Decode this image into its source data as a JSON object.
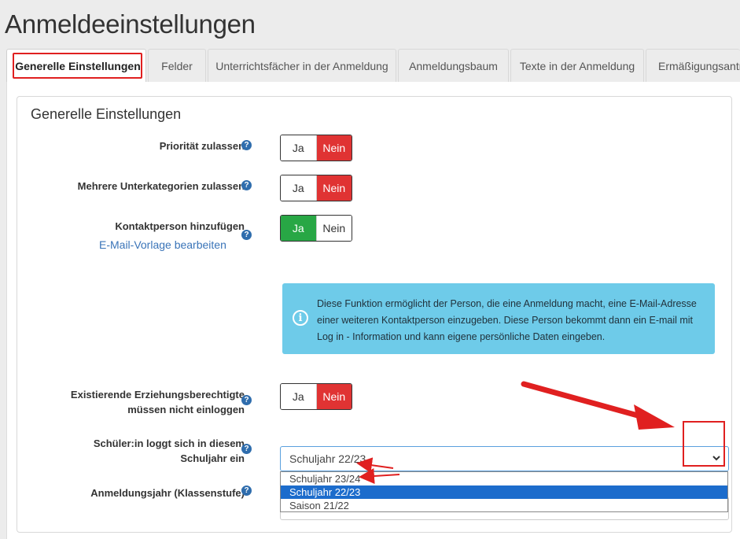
{
  "page": {
    "title": "Anmeldeeinstellungen"
  },
  "tabs": [
    {
      "label": "Generelle Einstellungen",
      "active": true
    },
    {
      "label": "Felder"
    },
    {
      "label": "Unterrichtsfächer in der Anmeldung"
    },
    {
      "label": "Anmeldungsbaum"
    },
    {
      "label": "Texte in der Anmeldung"
    },
    {
      "label": "Ermäßigungsanträ"
    }
  ],
  "panel": {
    "title": "Generelle Einstellungen",
    "prioritaet": {
      "label": "Priorität zulassen?",
      "yes": "Ja",
      "no": "Nein",
      "value": "Nein"
    },
    "unterkategorien": {
      "label": "Mehrere Unterkategorien zulassen?",
      "yes": "Ja",
      "no": "Nein",
      "value": "Nein"
    },
    "kontaktperson": {
      "label": "Kontaktperson hinzufügen",
      "link": "E-Mail-Vorlage bearbeiten",
      "yes": "Ja",
      "no": "Nein",
      "value": "Ja"
    },
    "info": {
      "text": "Diese Funktion ermöglicht der Person, die eine Anmeldung macht, eine E-Mail-Adresse einer weiteren Kontaktperson einzugeben. Diese Person bekommt dann ein E-mail mit Log in - Information und kann eigene persönliche Daten eingeben."
    },
    "erziehungsberechtigte": {
      "label_line1": "Existierende Erziehungsberechtigte",
      "label_line2": "müssen nicht einloggen",
      "yes": "Ja",
      "no": "Nein",
      "value": "Nein"
    },
    "schuljahr": {
      "label_line1": "Schüler:in loggt sich in diesem",
      "label_line2": "Schuljahr ein",
      "value": "Schuljahr 22/23",
      "options": [
        "Schuljahr 23/24",
        "Schuljahr 22/23",
        "Saison 21/22"
      ],
      "selected_index": 1
    },
    "anmeldungsjahr": {
      "label": "Anmeldungsjahr (Klassenstufe)"
    }
  },
  "icons": {
    "help": "question-circle-icon",
    "info": "info-circle-icon",
    "chevron": "chevron-down-icon"
  },
  "colors": {
    "red": "#e03333",
    "green": "#28a745",
    "info_bg": "#6ecbe9",
    "link": "#3a74b8",
    "annotation": "#e02020",
    "selected_option": "#1c6ccc"
  }
}
